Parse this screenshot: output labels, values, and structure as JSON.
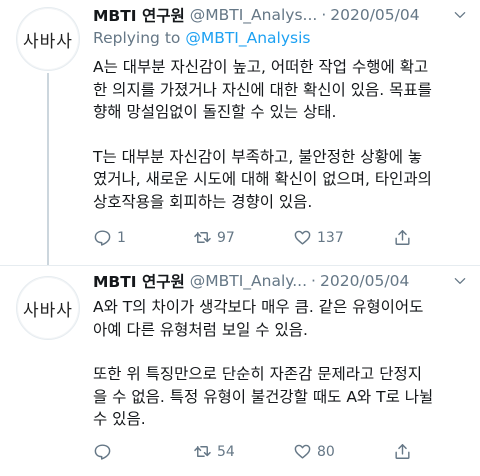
{
  "tweets": [
    {
      "avatar_text": "사바사",
      "name": "MBTI 연구원",
      "handle": "@MBTI_Analys...",
      "separator": "·",
      "date": "2020/05/04",
      "replying_prefix": "Replying to",
      "replying_to": "@MBTI_Analysis",
      "paragraphs": [
        "A는 대부분 자신감이 높고, 어떠한 작업 수행에 확고\n한 의지를 가졌거나 자신에 대한 확신이 있음. 목표를\n향해 망설임없이 돌진할 수 있는 상태.",
        "T는 대부분 자신감이 부족하고, 불안정한 상황에 놓\n였거나, 새로운 시도에 대해 확신이 없으며, 타인과의\n상호작용을 회피하는 경향이 있음."
      ],
      "reply_count": "1",
      "retweet_count": "97",
      "like_count": "137"
    },
    {
      "avatar_text": "사바사",
      "name": "MBTI 연구원",
      "handle": "@MBTI_Analy...",
      "separator": "·",
      "date": "2020/05/04",
      "paragraphs": [
        "A와 T의 차이가 생각보다 매우 큼. 같은 유형이어도\n아예 다른 유형처럼 보일 수 있음.",
        "또한 위 특징만으로 단순히 자존감 문제라고 단정지\n을 수 없음. 특정 유형이 불건강할 때도 A와 T로 나뉠\n수 있음."
      ],
      "reply_count": "",
      "retweet_count": "54",
      "like_count": "80"
    }
  ],
  "icons": {
    "more": "chevron-down-icon",
    "reply": "reply-icon",
    "retweet": "retweet-icon",
    "like": "heart-icon",
    "share": "share-icon"
  },
  "colors": {
    "text": "#14171a",
    "secondary": "#657786",
    "link": "#1da1f2",
    "divider": "#e6ecf0"
  }
}
